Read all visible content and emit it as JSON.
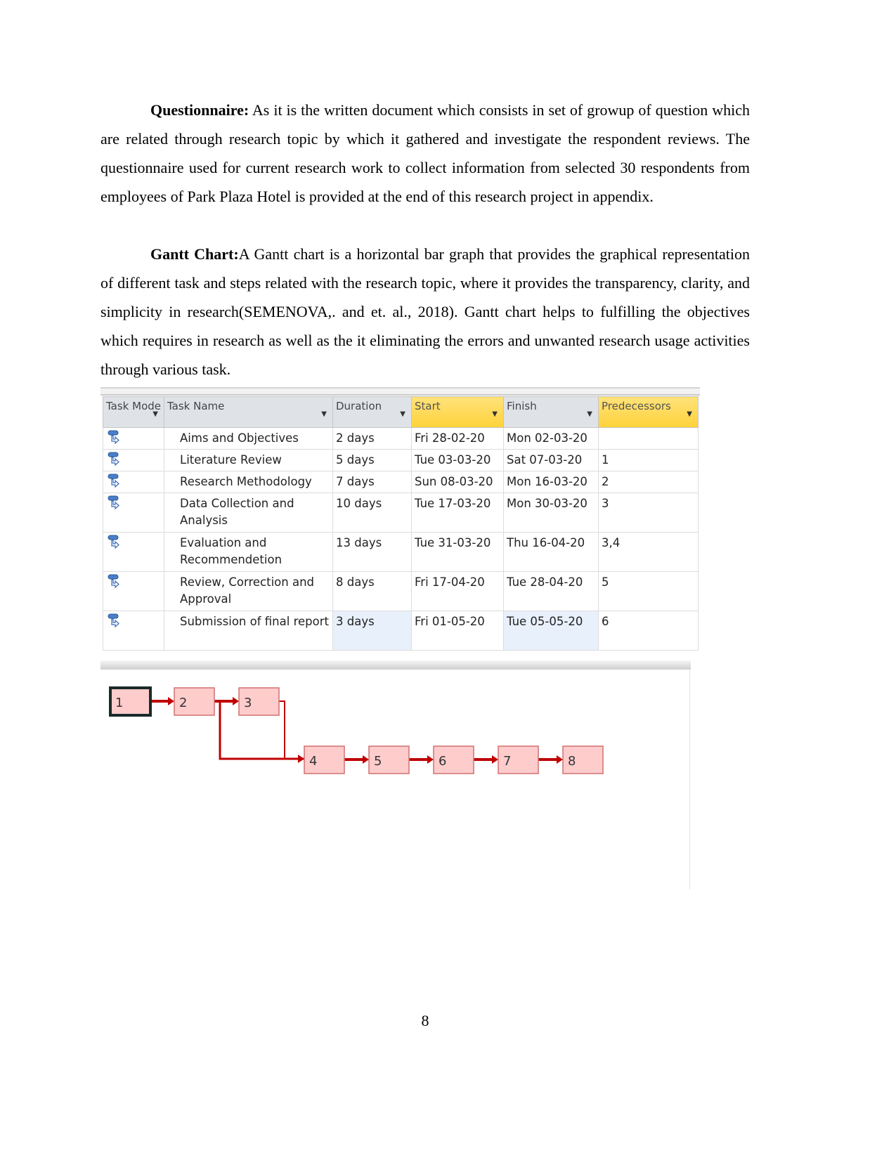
{
  "paragraphs": [
    {
      "heading": "Questionnaire:",
      "text": " As it is the written document which consists in set of growup of question which are related through research topic by which it gathered and investigate the respondent reviews. The questionnaire used for current research work to collect information from selected 30 respondents from employees of Park Plaza Hotel is provided at the end of this research project in appendix."
    },
    {
      "heading": "Gantt Chart:",
      "text": "A Gantt chart is a horizontal bar graph that provides the graphical representation of different task and steps related with the research topic, where it provides the transparency, clarity, and simplicity in research(SEMENOVA,. and et. al.,  2018). Gantt chart helps to fulfilling the objectives which requires in research as well as the it eliminating the errors and unwanted research usage activities through various task."
    }
  ],
  "table": {
    "headers": [
      "Task Mode",
      "Task Name",
      "Duration",
      "Start",
      "Finish",
      "Predecessors"
    ],
    "highlighted_headers": [
      "Start",
      "Predecessors"
    ],
    "rows": [
      {
        "name": "Aims and Objectives",
        "duration": "2 days",
        "start": "Fri 28-02-20",
        "finish": "Mon 02-03-20",
        "pred": ""
      },
      {
        "name": "Literature Review",
        "duration": "5 days",
        "start": "Tue 03-03-20",
        "finish": "Sat 07-03-20",
        "pred": "1"
      },
      {
        "name": "Research Methodology",
        "duration": "7 days",
        "start": "Sun 08-03-20",
        "finish": "Mon 16-03-20",
        "pred": "2"
      },
      {
        "name": "Data Collection and Analysis",
        "duration": "10 days",
        "start": "Tue 17-03-20",
        "finish": "Mon 30-03-20",
        "pred": "3"
      },
      {
        "name": "Evaluation and Recommendetion",
        "duration": "13 days",
        "start": "Tue 31-03-20",
        "finish": "Thu 16-04-20",
        "pred": "3,4"
      },
      {
        "name": "Review, Correction and Approval",
        "duration": "8 days",
        "start": "Fri 17-04-20",
        "finish": "Tue 28-04-20",
        "pred": "5"
      },
      {
        "name": "Submission of final report",
        "duration": "3 days",
        "start": "Fri 01-05-20",
        "finish": "Tue 05-05-20",
        "pred": "6"
      }
    ]
  },
  "network": {
    "nodes": [
      "1",
      "2",
      "3",
      "4",
      "5",
      "6",
      "7",
      "8"
    ],
    "colors": {
      "node_fill": "#ffcccc",
      "node_border": "#d07070",
      "link": "#c00000",
      "selected_border": "#1a2a28"
    }
  },
  "page_number": "8"
}
